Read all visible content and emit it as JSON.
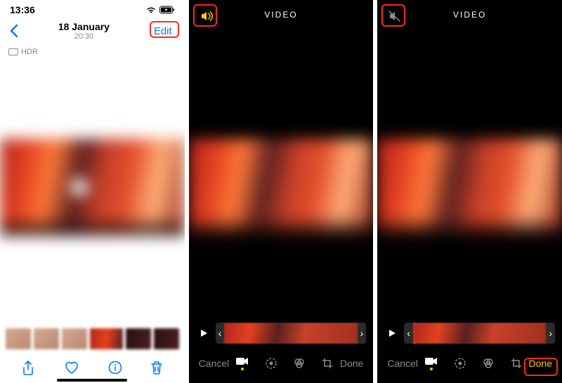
{
  "panel1": {
    "status": {
      "time": "13:36"
    },
    "header": {
      "date": "18 January",
      "time": "20:30",
      "edit": "Edit"
    },
    "hdr": "HDR"
  },
  "panel2": {
    "header": {
      "title": "VIDEO"
    },
    "toolbar": {
      "cancel": "Cancel",
      "done": "Done"
    }
  },
  "panel3": {
    "header": {
      "title": "VIDEO"
    },
    "toolbar": {
      "cancel": "Cancel",
      "done": "Done"
    }
  }
}
